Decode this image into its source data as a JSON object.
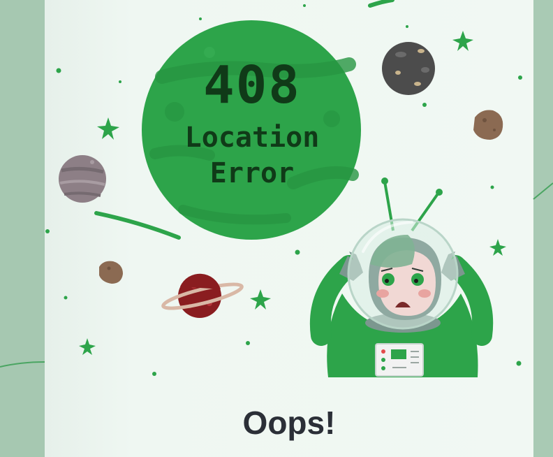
{
  "error": {
    "code": "408",
    "message_line_1": "Location",
    "message_line_2": "Error"
  },
  "heading": "Oops!",
  "colors": {
    "page_background": "#a7c8b2",
    "card_background": "#f1f8f3",
    "planet_green": "#2da44a",
    "text_dark": "#2b2f37",
    "code_text": "#103a18"
  },
  "icons": {
    "illustration": "astronaut-illustration",
    "main_planet": "green-planet-icon",
    "stars": "star-icon",
    "rocks": "asteroid-icon"
  }
}
